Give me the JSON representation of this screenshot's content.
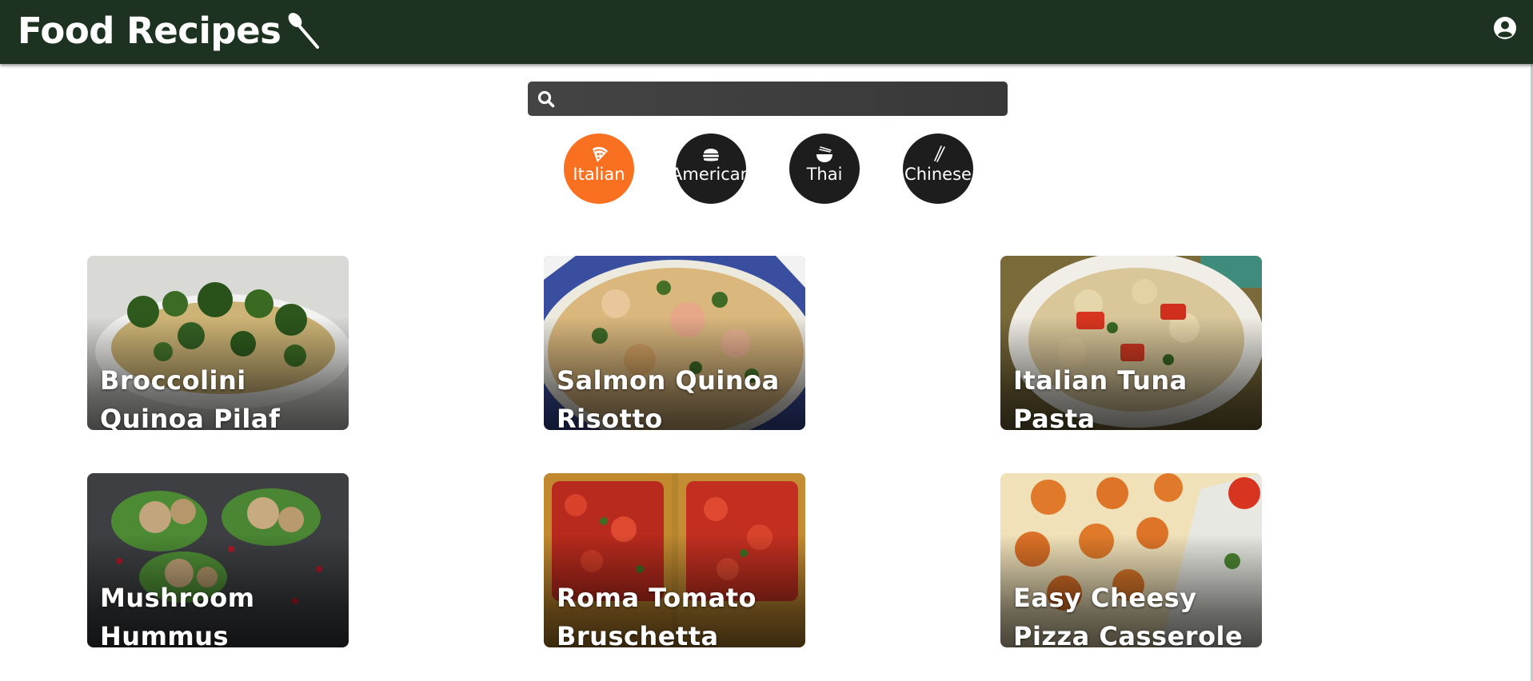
{
  "header": {
    "title": "Food Recipes",
    "logo_icon": "spoon-icon",
    "account_icon": "user-circle-icon",
    "background": "#1e3222"
  },
  "search": {
    "value": "",
    "placeholder": "",
    "icon": "search-icon"
  },
  "categories": [
    {
      "label": "Italian",
      "icon": "pizza-icon",
      "active": true
    },
    {
      "label": "American",
      "icon": "burger-icon",
      "active": false
    },
    {
      "label": "Thai",
      "icon": "noodle-bowl-icon",
      "active": false
    },
    {
      "label": "Chinese",
      "icon": "chopsticks-icon",
      "active": false
    }
  ],
  "colors": {
    "accent": "#f97120",
    "category_dark": "#1d1d1d"
  },
  "recipes": [
    {
      "title": "Broccolini Quinoa Pilaf"
    },
    {
      "title": "Salmon Quinoa Risotto"
    },
    {
      "title": "Italian Tuna Pasta"
    },
    {
      "title": "Mushroom Hummus"
    },
    {
      "title": "Roma Tomato Bruschetta"
    },
    {
      "title": "Easy Cheesy Pizza Casserole"
    }
  ]
}
